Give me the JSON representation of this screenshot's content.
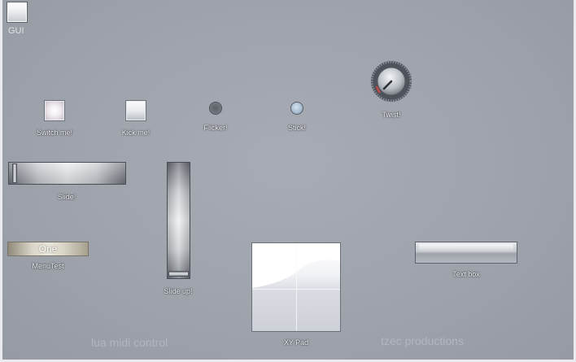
{
  "app": {
    "gui_label": "GUI"
  },
  "controls": {
    "switch_label": "Switch me!",
    "kick_label": "Kick me!",
    "flicker_label": "Flicker!",
    "stick_label": "Stick!",
    "twist_label": "Twist!",
    "slide_label": "Slide!",
    "slideup_label": "Slide up!",
    "menu_value": "One",
    "menu_label": "MenuTest",
    "xypad_label": "XY Pad",
    "textbox_label": "Text box"
  },
  "footer": {
    "left": "lua midi control",
    "right": "tzec productions"
  },
  "colors": {
    "background": "#9ea2aa",
    "frame": "#e9ebee",
    "label_text": "#f4f5f7"
  },
  "icons": {
    "knob": "rotary-knob-icon"
  }
}
